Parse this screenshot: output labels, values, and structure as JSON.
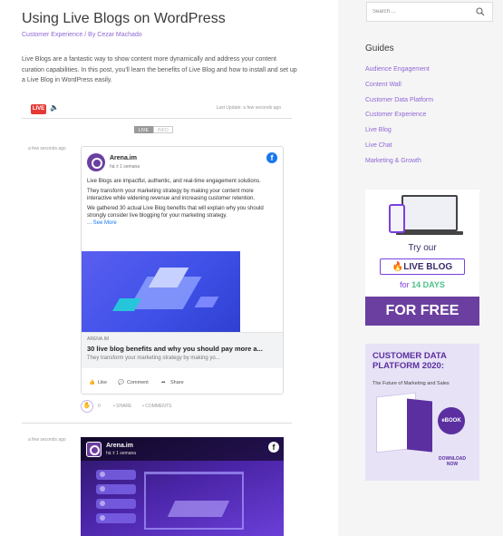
{
  "post": {
    "title": "Using Live Blogs on WordPress",
    "category": "Customer Experience",
    "separator": " / By ",
    "author": "Cezar Machado",
    "intro": "Live Blogs are a fantastic way to show content more dynamically and address your content curation capabilities. In this post, you'll learn the benefits of Live Blog and how to install and set up a Live Blog in WordPress easily."
  },
  "liveblog": {
    "live_badge": "LIVE",
    "speaker_icon": "speaker-icon",
    "last_update": "Last Update: a few seconds ago",
    "toggle_live": "LIVE",
    "toggle_info": "INFO",
    "entries": [
      {
        "timestamp": "a few seconds ago",
        "embed": {
          "page_name": "Arena.im",
          "page_sub": "há ± 1 semana",
          "paragraphs": [
            "Live Blogs are impactful, authentic, and real-time engagement solutions.",
            "They transform your marketing strategy by making your content more interactive while widening revenue and increasing customer retention.",
            "We gathered 30 actual Live Blog benefits that will explain why you should strongly consider live blogging for your marketing strategy."
          ],
          "see_more": "... See More",
          "link_domain": "ARENA.IM",
          "link_title": "30 live blog benefits and why you should pay more a...",
          "link_desc": "They transform your marketing strategy by making yo...",
          "actions": {
            "like": "Like",
            "comment": "Comment",
            "share": "Share"
          }
        },
        "reactions": {
          "count": "0",
          "share": "SHARE",
          "comments": "COMMENTS"
        }
      },
      {
        "timestamp": "a few seconds ago",
        "embed": {
          "page_name": "Arena.im",
          "page_sub": "há ± 1 semana"
        }
      }
    ]
  },
  "sidebar": {
    "search_placeholder": "Search ...",
    "guides_title": "Guides",
    "guides": [
      "Audience Engagement",
      "Content Wall",
      "Customer Data Platform",
      "Customer Experience",
      "Live Blog",
      "Live Chat",
      "Marketing & Growth"
    ],
    "ad1": {
      "try": "Try our",
      "live_blog": "LIVE BLOG",
      "for": "for",
      "days": "14 DAYS",
      "free": "FOR FREE"
    },
    "ad2": {
      "title": "CUSTOMER DATA PLATFORM 2020:",
      "subtitle": "The Future of Marketing and Sales",
      "ebook": "eBOOK",
      "download": "DOWNLOAD NOW"
    }
  },
  "colors": {
    "accent": "#8f67d6",
    "brand_purple": "#6b3fa0",
    "live_red": "#e53935",
    "facebook_blue": "#1877f2"
  }
}
